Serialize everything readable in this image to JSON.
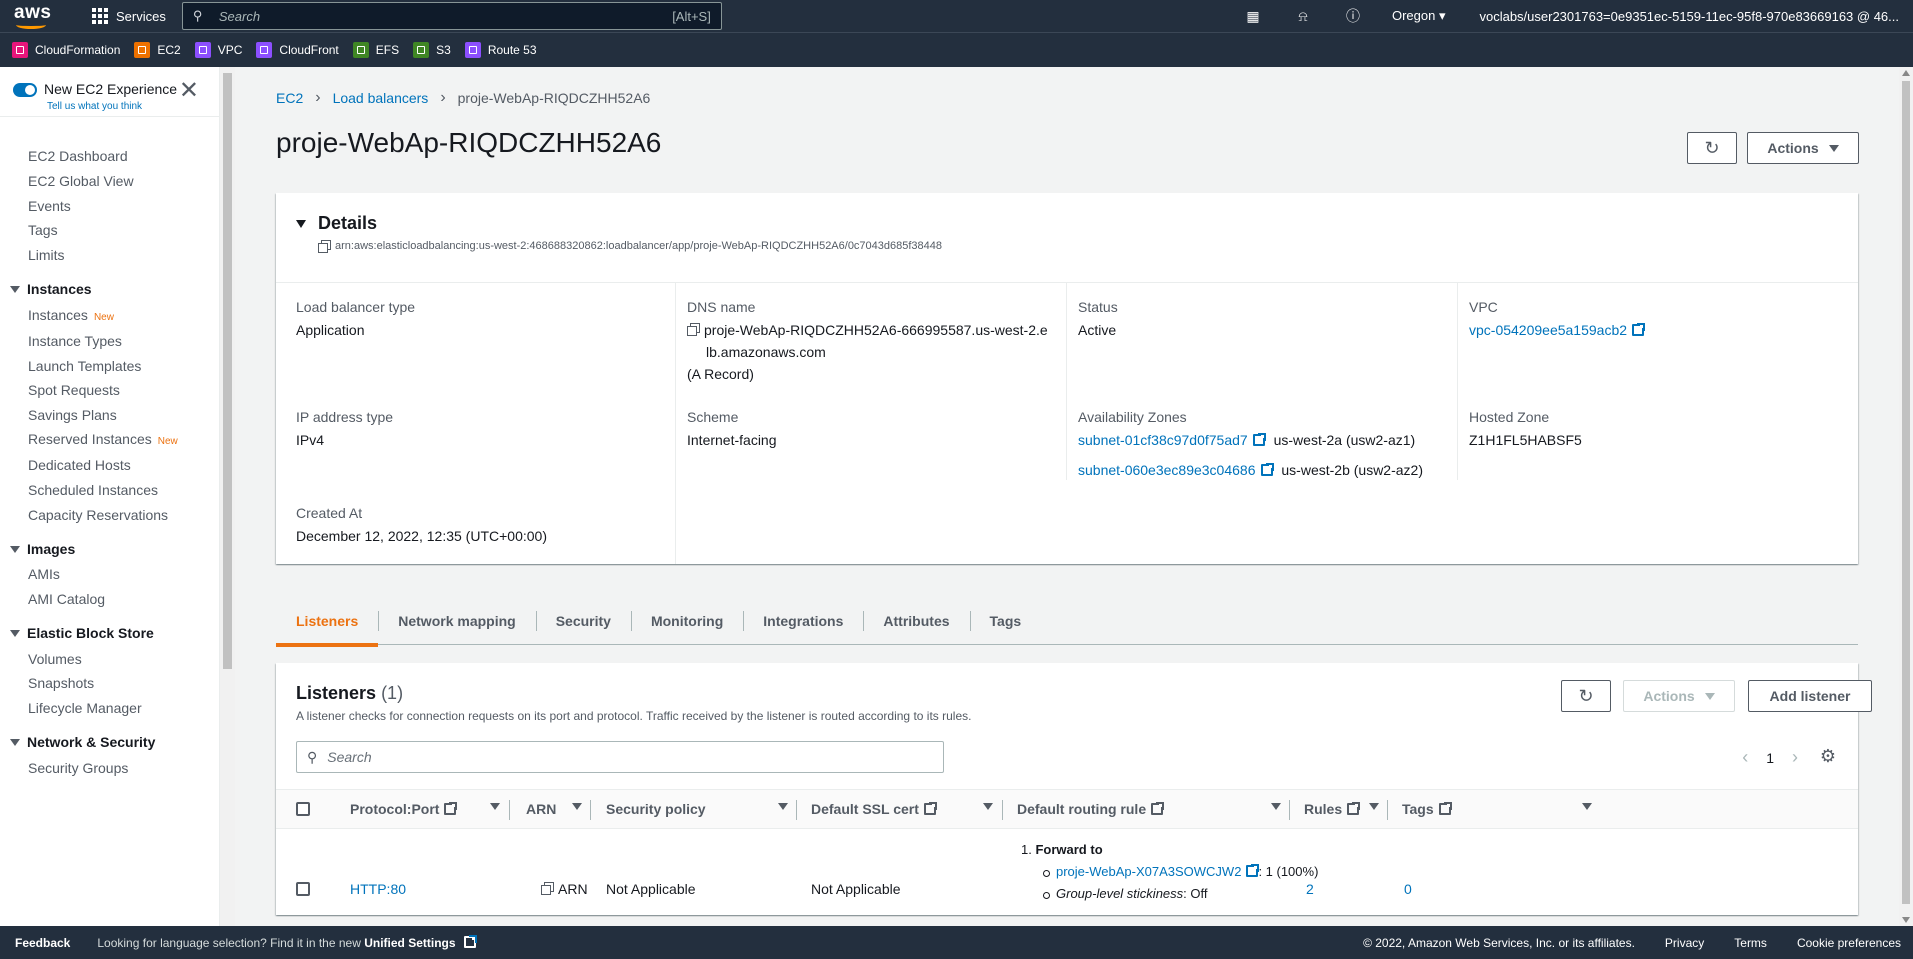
{
  "topbar": {
    "logo": "aws",
    "services_label": "Services",
    "search_placeholder": "Search",
    "search_shortcut": "[Alt+S]",
    "region": "Oregon",
    "account": "voclabs/user2301763=0e9351ec-5159-11ec-95f8-970e83669163 @ 46..."
  },
  "favorites": [
    {
      "label": "CloudFormation",
      "color": "#e7157b"
    },
    {
      "label": "EC2",
      "color": "#ed7100"
    },
    {
      "label": "VPC",
      "color": "#8c4fff"
    },
    {
      "label": "CloudFront",
      "color": "#8c4fff"
    },
    {
      "label": "EFS",
      "color": "#3f8624"
    },
    {
      "label": "S3",
      "color": "#3f8624"
    },
    {
      "label": "Route 53",
      "color": "#8c4fff"
    }
  ],
  "sidebar": {
    "new_experience": "New EC2 Experience",
    "feedback_link": "Tell us what you think",
    "items": {
      "dashboard": "EC2 Dashboard",
      "global_view": "EC2 Global View",
      "events": "Events",
      "tags": "Tags",
      "limits": "Limits",
      "instances_head": "Instances",
      "instances": "Instances",
      "new_badge": "New",
      "instance_types": "Instance Types",
      "launch_templates": "Launch Templates",
      "spot_requests": "Spot Requests",
      "savings_plans": "Savings Plans",
      "reserved_instances": "Reserved Instances",
      "dedicated_hosts": "Dedicated Hosts",
      "scheduled_instances": "Scheduled Instances",
      "capacity_reservations": "Capacity Reservations",
      "images_head": "Images",
      "amis": "AMIs",
      "ami_catalog": "AMI Catalog",
      "ebs_head": "Elastic Block Store",
      "volumes": "Volumes",
      "snapshots": "Snapshots",
      "lifecycle_manager": "Lifecycle Manager",
      "netsec_head": "Network & Security",
      "security_groups": "Security Groups"
    }
  },
  "breadcrumb": [
    "EC2",
    "Load balancers",
    "proje-WebAp-RIQDCZHH52A6"
  ],
  "page": {
    "title": "proje-WebAp-RIQDCZHH52A6",
    "actions_label": "Actions"
  },
  "details": {
    "heading": "Details",
    "arn": "arn:aws:elasticloadbalancing:us-west-2:468688320862:loadbalancer/app/proje-WebAp-RIQDCZHH52A6/0c7043d685f38448",
    "lb_type_label": "Load balancer type",
    "lb_type": "Application",
    "dns_label": "DNS name",
    "dns_line1": "proje-WebAp-RIQDCZHH52A6-666995587.us-west-2.e",
    "dns_line2": "lb.amazonaws.com",
    "dns_record": "(A Record)",
    "status_label": "Status",
    "status": "Active",
    "vpc_label": "VPC",
    "vpc": "vpc-054209ee5a159acb2",
    "ip_label": "IP address type",
    "ip": "IPv4",
    "scheme_label": "Scheme",
    "scheme": "Internet-facing",
    "az_label": "Availability Zones",
    "az1_subnet": "subnet-01cf38c97d0f75ad7",
    "az1_zone": "us-west-2a (usw2-az1)",
    "az2_subnet": "subnet-060e3ec89e3c04686",
    "az2_zone": "us-west-2b (usw2-az2)",
    "hosted_label": "Hosted Zone",
    "hosted": "Z1H1FL5HABSF5",
    "created_label": "Created At",
    "created": "December 12, 2022, 12:35 (UTC+00:00)"
  },
  "tabs": [
    "Listeners",
    "Network mapping",
    "Security",
    "Monitoring",
    "Integrations",
    "Attributes",
    "Tags"
  ],
  "listeners": {
    "title": "Listeners",
    "count": "(1)",
    "description": "A listener checks for connection requests on its port and protocol. Traffic received by the listener is routed according to its rules.",
    "actions_label": "Actions",
    "add_label": "Add listener",
    "search_placeholder": "Search",
    "page": "1",
    "columns": [
      "Protocol:Port",
      "ARN",
      "Security policy",
      "Default SSL cert",
      "Default routing rule",
      "Rules",
      "Tags"
    ],
    "row": {
      "protocol_port": "HTTP:80",
      "arn": "ARN",
      "security_policy": "Not Applicable",
      "ssl_cert": "Not Applicable",
      "rule_num": "1.",
      "rule_action": "Forward to",
      "target_group": "proje-WebAp-X07A3SOWCJW2",
      "target_weight": ": 1 (100%)",
      "stickiness_label": "Group-level stickiness",
      "stickiness_value": ": Off",
      "rules": "2",
      "tags": "0"
    }
  },
  "footer": {
    "feedback": "Feedback",
    "lang_text": "Looking for language selection? Find it in the new",
    "lang_link": "Unified Settings",
    "copyright": "© 2022, Amazon Web Services, Inc. or its affiliates.",
    "privacy": "Privacy",
    "terms": "Terms",
    "cookies": "Cookie preferences"
  }
}
